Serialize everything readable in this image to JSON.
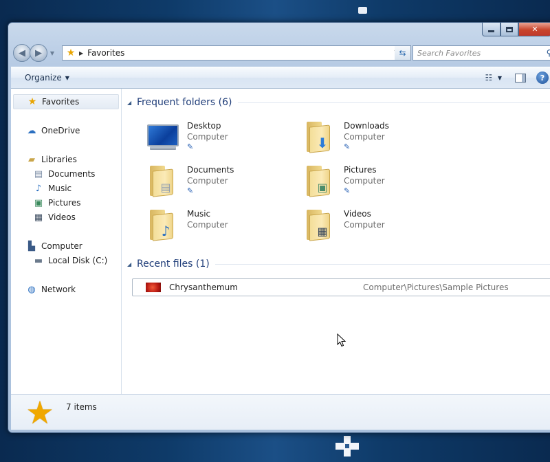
{
  "window": {
    "caption": {
      "minimize": "",
      "maximize": "",
      "close": "✕"
    }
  },
  "address": {
    "location": "Favorites"
  },
  "search": {
    "placeholder": "Search Favorites"
  },
  "toolbar": {
    "organize_label": "Organize"
  },
  "sidebar": {
    "favorites": "Favorites",
    "onedrive": "OneDrive",
    "libraries": "Libraries",
    "library_items": [
      "Documents",
      "Music",
      "Pictures",
      "Videos"
    ],
    "computer": "Computer",
    "local_disk": "Local Disk (C:)",
    "network": "Network"
  },
  "frequent": {
    "title": "Frequent folders (6)",
    "folders": [
      {
        "name": "Desktop",
        "location": "Computer",
        "icon": "desktop-icon"
      },
      {
        "name": "Downloads",
        "location": "Computer",
        "icon": "downloads-folder-icon"
      },
      {
        "name": "Documents",
        "location": "Computer",
        "icon": "documents-folder-icon"
      },
      {
        "name": "Pictures",
        "location": "Computer",
        "icon": "pictures-folder-icon"
      },
      {
        "name": "Music",
        "location": "Computer",
        "icon": "music-folder-icon"
      },
      {
        "name": "Videos",
        "location": "Computer",
        "icon": "videos-folder-icon"
      }
    ]
  },
  "recent": {
    "title": "Recent files (1)",
    "files": [
      {
        "name": "Chrysanthemum",
        "path": "Computer\\Pictures\\Sample Pictures"
      }
    ]
  },
  "details": {
    "count": "7 items"
  },
  "colors": {
    "accent_text": "#1e3c78",
    "folder": "#f3de99",
    "close_button": "#c8452c"
  }
}
